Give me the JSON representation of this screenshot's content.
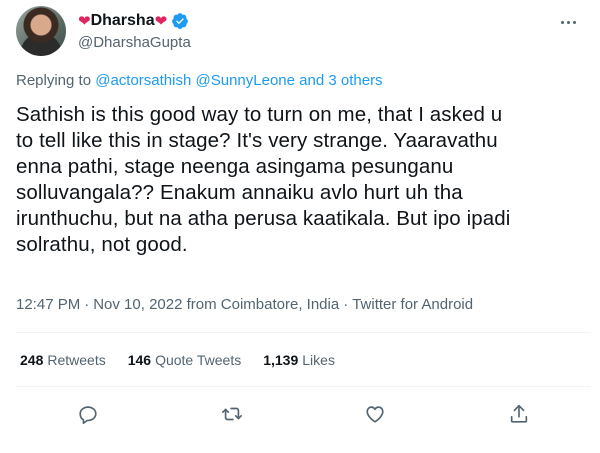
{
  "author": {
    "display_name": "Dharsha",
    "handle": "@DharshaGupta",
    "verified": true,
    "name_decoration": "heart"
  },
  "reply_context": {
    "prefix": "Replying to",
    "mentions": [
      "@actorsathish",
      "@SunnyLeone"
    ],
    "and_text": "and",
    "others": "3 others"
  },
  "tweet": {
    "text": "Sathish is this good way to turn on me, that I asked u\nto tell like this in stage? It's very strange. Yaaravathu\nenna pathi, stage neenga asingama pesunganu\nsolluvangala?? Enakum annaiku avlo hurt uh tha\nirunthuchu, but na atha perusa kaatikala. But ipo ipadi\nsolrathu, not good.",
    "time": "12:47 PM",
    "date": "Nov 10, 2022",
    "location": "from Coimbatore, India",
    "source": "Twitter for Android",
    "separator": "·"
  },
  "stats": [
    {
      "count": "248",
      "label": "Retweets"
    },
    {
      "count": "146",
      "label": "Quote Tweets"
    },
    {
      "count": "1,139",
      "label": "Likes"
    }
  ],
  "actions": [
    "reply-icon",
    "retweet-icon",
    "like-icon",
    "share-icon"
  ],
  "colors": {
    "accent": "#1d9bf0",
    "heart": "#e0245e",
    "muted": "#536471",
    "text": "#0f1419",
    "divider": "#eff3f4"
  }
}
